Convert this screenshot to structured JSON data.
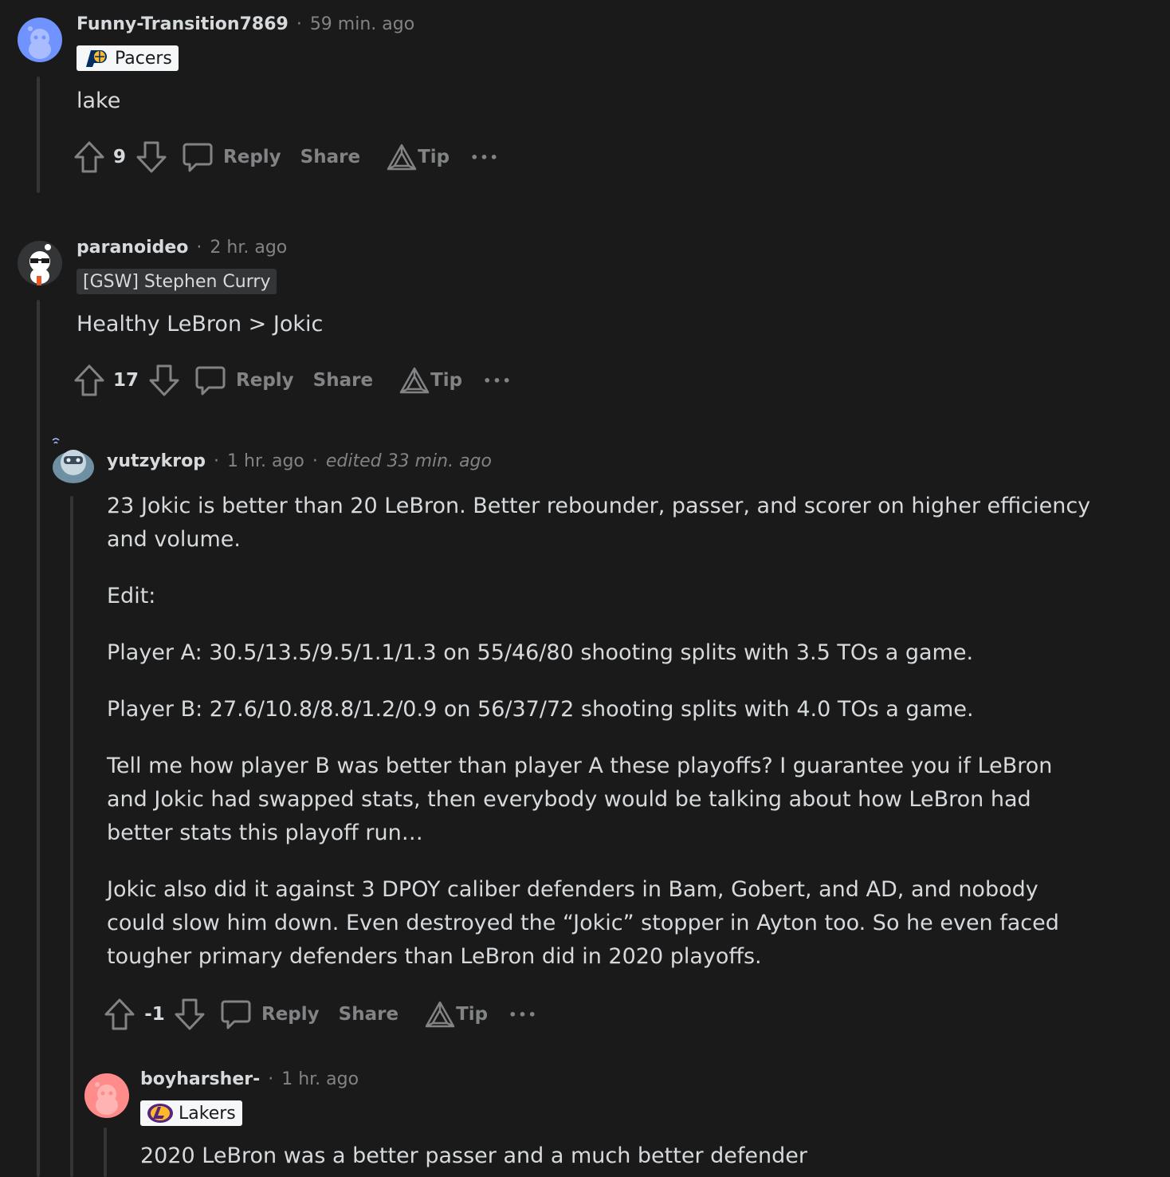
{
  "comments": [
    {
      "username": "Funny-Transition7869",
      "time": "59 min. ago",
      "flair": "Pacers",
      "body": [
        "lake"
      ],
      "votes": "9",
      "reply": "Reply",
      "share": "Share",
      "tip": "Tip",
      "more": "•••"
    },
    {
      "username": "paranoideo",
      "time": "2 hr. ago",
      "flair": "[GSW] Stephen Curry",
      "body": [
        "Healthy LeBron > Jokic"
      ],
      "votes": "17",
      "reply": "Reply",
      "share": "Share",
      "tip": "Tip",
      "more": "•••"
    },
    {
      "username": "yutzykrop",
      "time": "1 hr. ago",
      "edited": "edited 33 min. ago",
      "body": [
        "23 Jokic is better than 20 LeBron. Better rebounder, passer, and scorer on higher efficiency and volume.",
        "Edit:",
        "Player A: 30.5/13.5/9.5/1.1/1.3 on 55/46/80 shooting splits with 3.5 TOs a game.",
        "Player B: 27.6/10.8/8.8/1.2/0.9 on 56/37/72 shooting splits with 4.0 TOs a game.",
        "Tell me how player B was better than player A these playoffs? I guarantee you if LeBron and Jokic had swapped stats, then everybody would be talking about how LeBron had better stats this playoff run…",
        "Jokic also did it against 3 DPOY caliber defenders in Bam, Gobert, and AD, and nobody could slow him down. Even destroyed the “Jokic” stopper in Ayton too. So he even faced tougher primary defenders than LeBron did in 2020 playoffs."
      ],
      "votes": "-1",
      "reply": "Reply",
      "share": "Share",
      "tip": "Tip",
      "more": "•••"
    },
    {
      "username": "boyharsher-",
      "time": "1 hr. ago",
      "flair": "Lakers",
      "body": [
        "2020 LeBron was a better passer and a much better defender"
      ]
    }
  ],
  "separator": "·",
  "colors": {
    "background": "#1a1a1b",
    "text": "#d7dadc",
    "muted": "#818384",
    "thread_line": "#343536",
    "avatar_blue": "#7193ff",
    "avatar_pink": "#ff8b8b"
  },
  "icons": [
    "upvote-icon",
    "downvote-icon",
    "comment-icon",
    "tip-icon",
    "more-icon"
  ]
}
